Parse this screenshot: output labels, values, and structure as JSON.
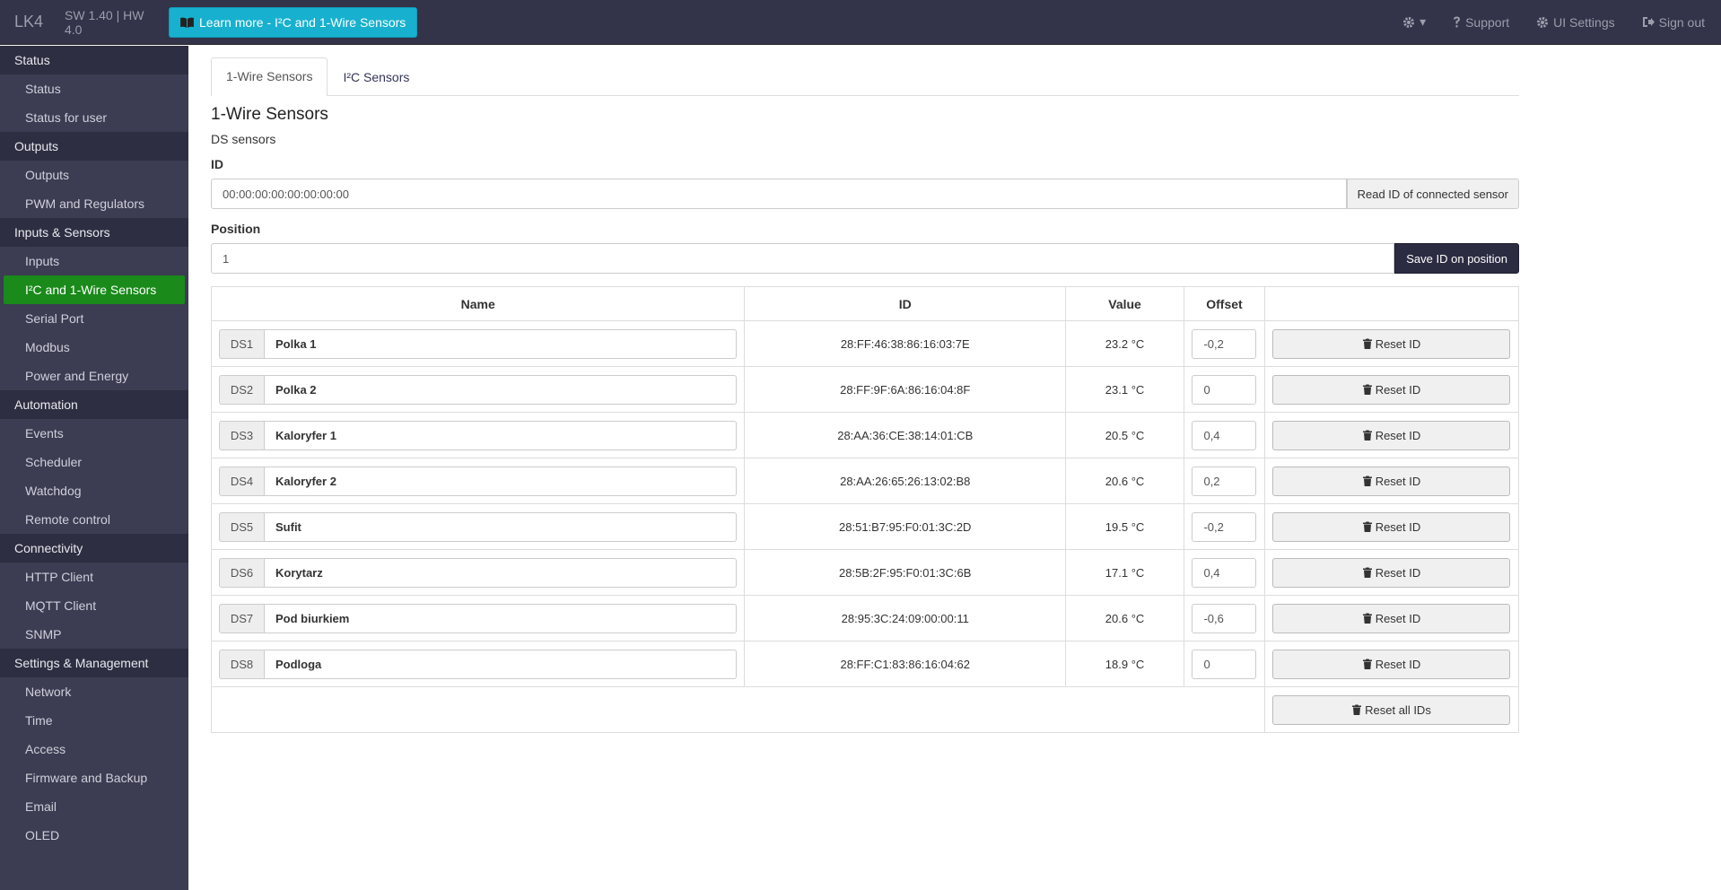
{
  "header": {
    "brand": "LK4",
    "version": "SW 1.40 | HW 4.0",
    "learn_more_label": "Learn more - I²C and 1-Wire Sensors",
    "links": {
      "gear_caret": "▾",
      "support": "Support",
      "ui_settings": "UI Settings",
      "sign_out": "Sign out"
    }
  },
  "sidebar": {
    "groups": [
      {
        "title": "Status",
        "items": [
          "Status",
          "Status for user"
        ]
      },
      {
        "title": "Outputs",
        "items": [
          "Outputs",
          "PWM and Regulators"
        ]
      },
      {
        "title": "Inputs & Sensors",
        "items": [
          "Inputs",
          "I²C and 1-Wire Sensors",
          "Serial Port",
          "Modbus",
          "Power and Energy"
        ]
      },
      {
        "title": "Automation",
        "items": [
          "Events",
          "Scheduler",
          "Watchdog",
          "Remote control"
        ]
      },
      {
        "title": "Connectivity",
        "items": [
          "HTTP Client",
          "MQTT Client",
          "SNMP"
        ]
      },
      {
        "title": "Settings & Management",
        "items": [
          "Network",
          "Time",
          "Access",
          "Firmware and Backup",
          "Email",
          "OLED"
        ]
      }
    ],
    "active_item": "I²C and 1-Wire Sensors",
    "active_color": "#1a8a1a"
  },
  "tabs": [
    {
      "label": "1-Wire Sensors",
      "active": true
    },
    {
      "label": "I²C Sensors",
      "active": false
    }
  ],
  "section": {
    "title": "1-Wire Sensors",
    "subtitle": "DS sensors",
    "id_label": "ID",
    "id_value": "00:00:00:00:00:00:00:00",
    "read_id_button": "Read ID of connected sensor",
    "position_label": "Position",
    "position_value": "1",
    "save_button": "Save ID on position"
  },
  "table": {
    "columns": [
      "Name",
      "ID",
      "Value",
      "Offset",
      ""
    ],
    "rows": [
      {
        "slot": "DS1",
        "name": "Polka 1",
        "id": "28:FF:46:38:86:16:03:7E",
        "value": "23.2 °C",
        "offset": "-0,2",
        "reset": "Reset ID"
      },
      {
        "slot": "DS2",
        "name": "Polka 2",
        "id": "28:FF:9F:6A:86:16:04:8F",
        "value": "23.1 °C",
        "offset": "0",
        "reset": "Reset ID"
      },
      {
        "slot": "DS3",
        "name": "Kaloryfer 1",
        "id": "28:AA:36:CE:38:14:01:CB",
        "value": "20.5 °C",
        "offset": "0,4",
        "reset": "Reset ID"
      },
      {
        "slot": "DS4",
        "name": "Kaloryfer 2",
        "id": "28:AA:26:65:26:13:02:B8",
        "value": "20.6 °C",
        "offset": "0,2",
        "reset": "Reset ID"
      },
      {
        "slot": "DS5",
        "name": "Sufit",
        "id": "28:51:B7:95:F0:01:3C:2D",
        "value": "19.5 °C",
        "offset": "-0,2",
        "reset": "Reset ID"
      },
      {
        "slot": "DS6",
        "name": "Korytarz",
        "id": "28:5B:2F:95:F0:01:3C:6B",
        "value": "17.1 °C",
        "offset": "0,4",
        "reset": "Reset ID"
      },
      {
        "slot": "DS7",
        "name": "Pod biurkiem",
        "id": "28:95:3C:24:09:00:00:11",
        "value": "20.6 °C",
        "offset": "-0,6",
        "reset": "Reset ID"
      },
      {
        "slot": "DS8",
        "name": "Podloga",
        "id": "28:FF:C1:83:86:16:04:62",
        "value": "18.9 °C",
        "offset": "0",
        "reset": "Reset ID"
      }
    ],
    "reset_all_label": "Reset all IDs"
  },
  "icons": {
    "book": "book-icon",
    "gear": "gear-icon",
    "question": "question-icon",
    "settings": "gear-icon",
    "signout": "sign-out-icon",
    "trash": "trash-icon"
  }
}
